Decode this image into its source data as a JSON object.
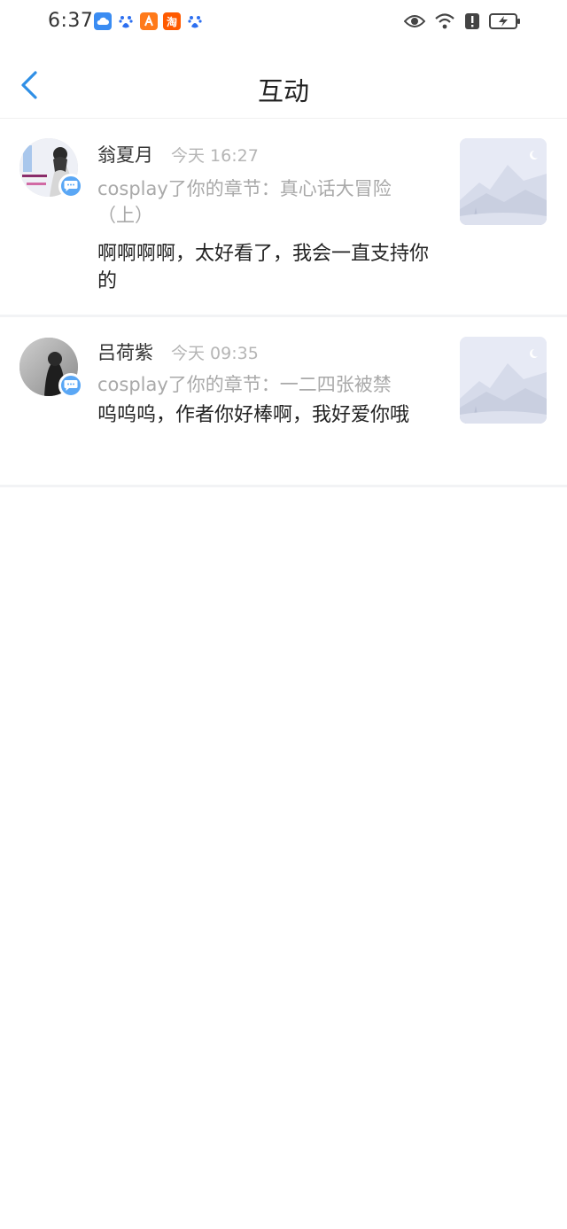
{
  "status_bar": {
    "time": "6:37",
    "notification_icons": [
      "cloud-icon",
      "baidu-icon",
      "app-icon",
      "taobao-icon",
      "baidu-icon"
    ],
    "taobao_label": "淘",
    "system_icons": [
      "eye-icon",
      "wifi-icon",
      "alert-icon",
      "battery-charging-icon"
    ]
  },
  "header": {
    "title": "互动"
  },
  "interactions": [
    {
      "name": "翁夏月",
      "time": "今天 16:27",
      "subtitle": "cosplay了你的章节：真心话大冒险（上）",
      "comment": "啊啊啊啊，太好看了，我会一直支持你的"
    },
    {
      "name": "吕荷紫",
      "time": "今天 09:35",
      "subtitle": "cosplay了你的章节：一二四张被禁",
      "comment": "呜呜呜，作者你好棒啊，我好爱你哦"
    }
  ]
}
